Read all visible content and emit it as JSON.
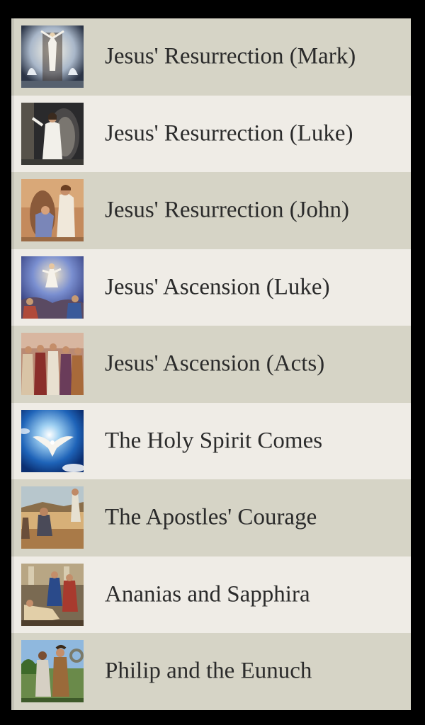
{
  "lessons": [
    {
      "title": "Jesus' Resurrection (Mark)",
      "icon": "resurrection-mark-thumbnail-icon"
    },
    {
      "title": "Jesus' Resurrection (Luke)",
      "icon": "resurrection-luke-thumbnail-icon"
    },
    {
      "title": "Jesus' Resurrection (John)",
      "icon": "resurrection-john-thumbnail-icon"
    },
    {
      "title": "Jesus' Ascension (Luke)",
      "icon": "ascension-luke-thumbnail-icon"
    },
    {
      "title": "Jesus' Ascension (Acts)",
      "icon": "ascension-acts-thumbnail-icon"
    },
    {
      "title": "The Holy Spirit Comes",
      "icon": "dove-thumbnail-icon"
    },
    {
      "title": "The Apostles' Courage",
      "icon": "apostles-courage-thumbnail-icon"
    },
    {
      "title": "Ananias and Sapphira",
      "icon": "ananias-sapphira-thumbnail-icon"
    },
    {
      "title": "Philip and the Eunuch",
      "icon": "philip-eunuch-thumbnail-icon"
    }
  ],
  "colors": {
    "row_dark": "#d6d4c6",
    "row_light": "#efece6",
    "text": "#2b2b2b",
    "frame": "#000000"
  }
}
